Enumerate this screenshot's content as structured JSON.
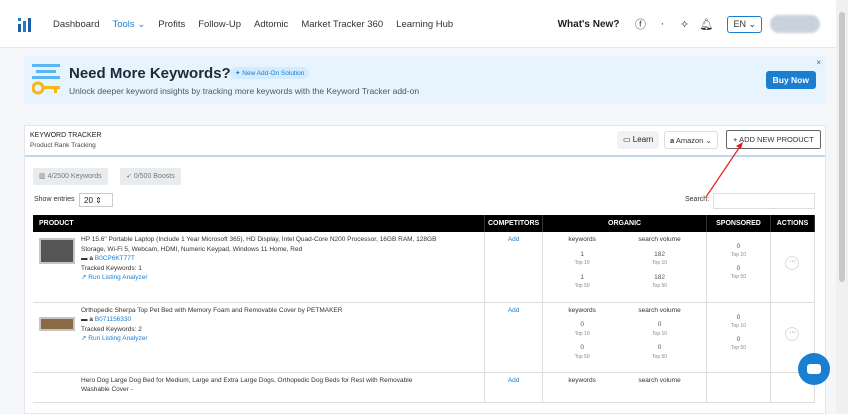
{
  "nav": {
    "items": [
      "Dashboard",
      "Tools",
      "Profits",
      "Follow-Up",
      "Adtomic",
      "Market Tracker 360",
      "Learning Hub"
    ],
    "whats_new": "What's New?",
    "language": "EN"
  },
  "banner": {
    "title": "Need More Keywords?",
    "tag": "New Add-On Solution",
    "subtitle": "Unlock deeper keyword insights by tracking more keywords with the Keyword Tracker add-on",
    "buy_now": "Buy Now",
    "close": "×"
  },
  "tracker": {
    "title": "KEYWORD TRACKER",
    "subtitle": "Product Rank Tracking",
    "learn": "Learn",
    "marketplace": "Amazon",
    "add_product": "ADD NEW PRODUCT",
    "keywords_pill": "4/2500 Keywords",
    "boosts_pill": "0/500 Boosts",
    "show_entries": "Show entries",
    "entries_value": "20",
    "search_label": "Search:"
  },
  "table": {
    "headers": [
      "PRODUCT",
      "COMPETITORS",
      "ORGANIC",
      "SPONSORED",
      "ACTIONS"
    ],
    "rows": [
      {
        "title": "HP 15.6\" Portable Laptop (Include 1 Year Microsoft 365), HD Display, Intel Quad-Core N200 Processor, 16GB RAM, 128GB Storage, Wi-Fi 5, Webcam, HDMI, Numeric Keypad, Windows 11 Home, Red",
        "asin": "B0CP6KT77T",
        "tracked": "Tracked Keywords: 1",
        "analyzer": "Run Listing Analyzer",
        "competitors": "Add",
        "kw_label": "keywords",
        "kw_top10": "1",
        "kw_top50": "1",
        "sv_label": "search volume",
        "sv_top10": "182",
        "sv_top50": "182",
        "sp_top10": "0",
        "sp_top50": "0"
      },
      {
        "title": "Orthopedic Sherpa Top Pet Bed with Memory Foam and Removable Cover by PETMAKER",
        "asin": "B071156330",
        "tracked": "Tracked Keywords: 2",
        "analyzer": "Run Listing Analyzer",
        "competitors": "Add",
        "kw_label": "keywords",
        "kw_top10": "0",
        "kw_top50": "0",
        "sv_label": "search volume",
        "sv_top10": "0",
        "sv_top50": "0",
        "sp_top10": "0",
        "sp_top50": "0"
      },
      {
        "title": "Hero Dog Large Dog Bed for Medium, Large and Extra Large Dogs, Orthopedic Dog Beds for Rest with Removable Washable Cover -",
        "competitors": "Add",
        "kw_label": "keywords",
        "sv_label": "search volume"
      }
    ],
    "top10": "Top 10",
    "top50": "Top 50"
  }
}
